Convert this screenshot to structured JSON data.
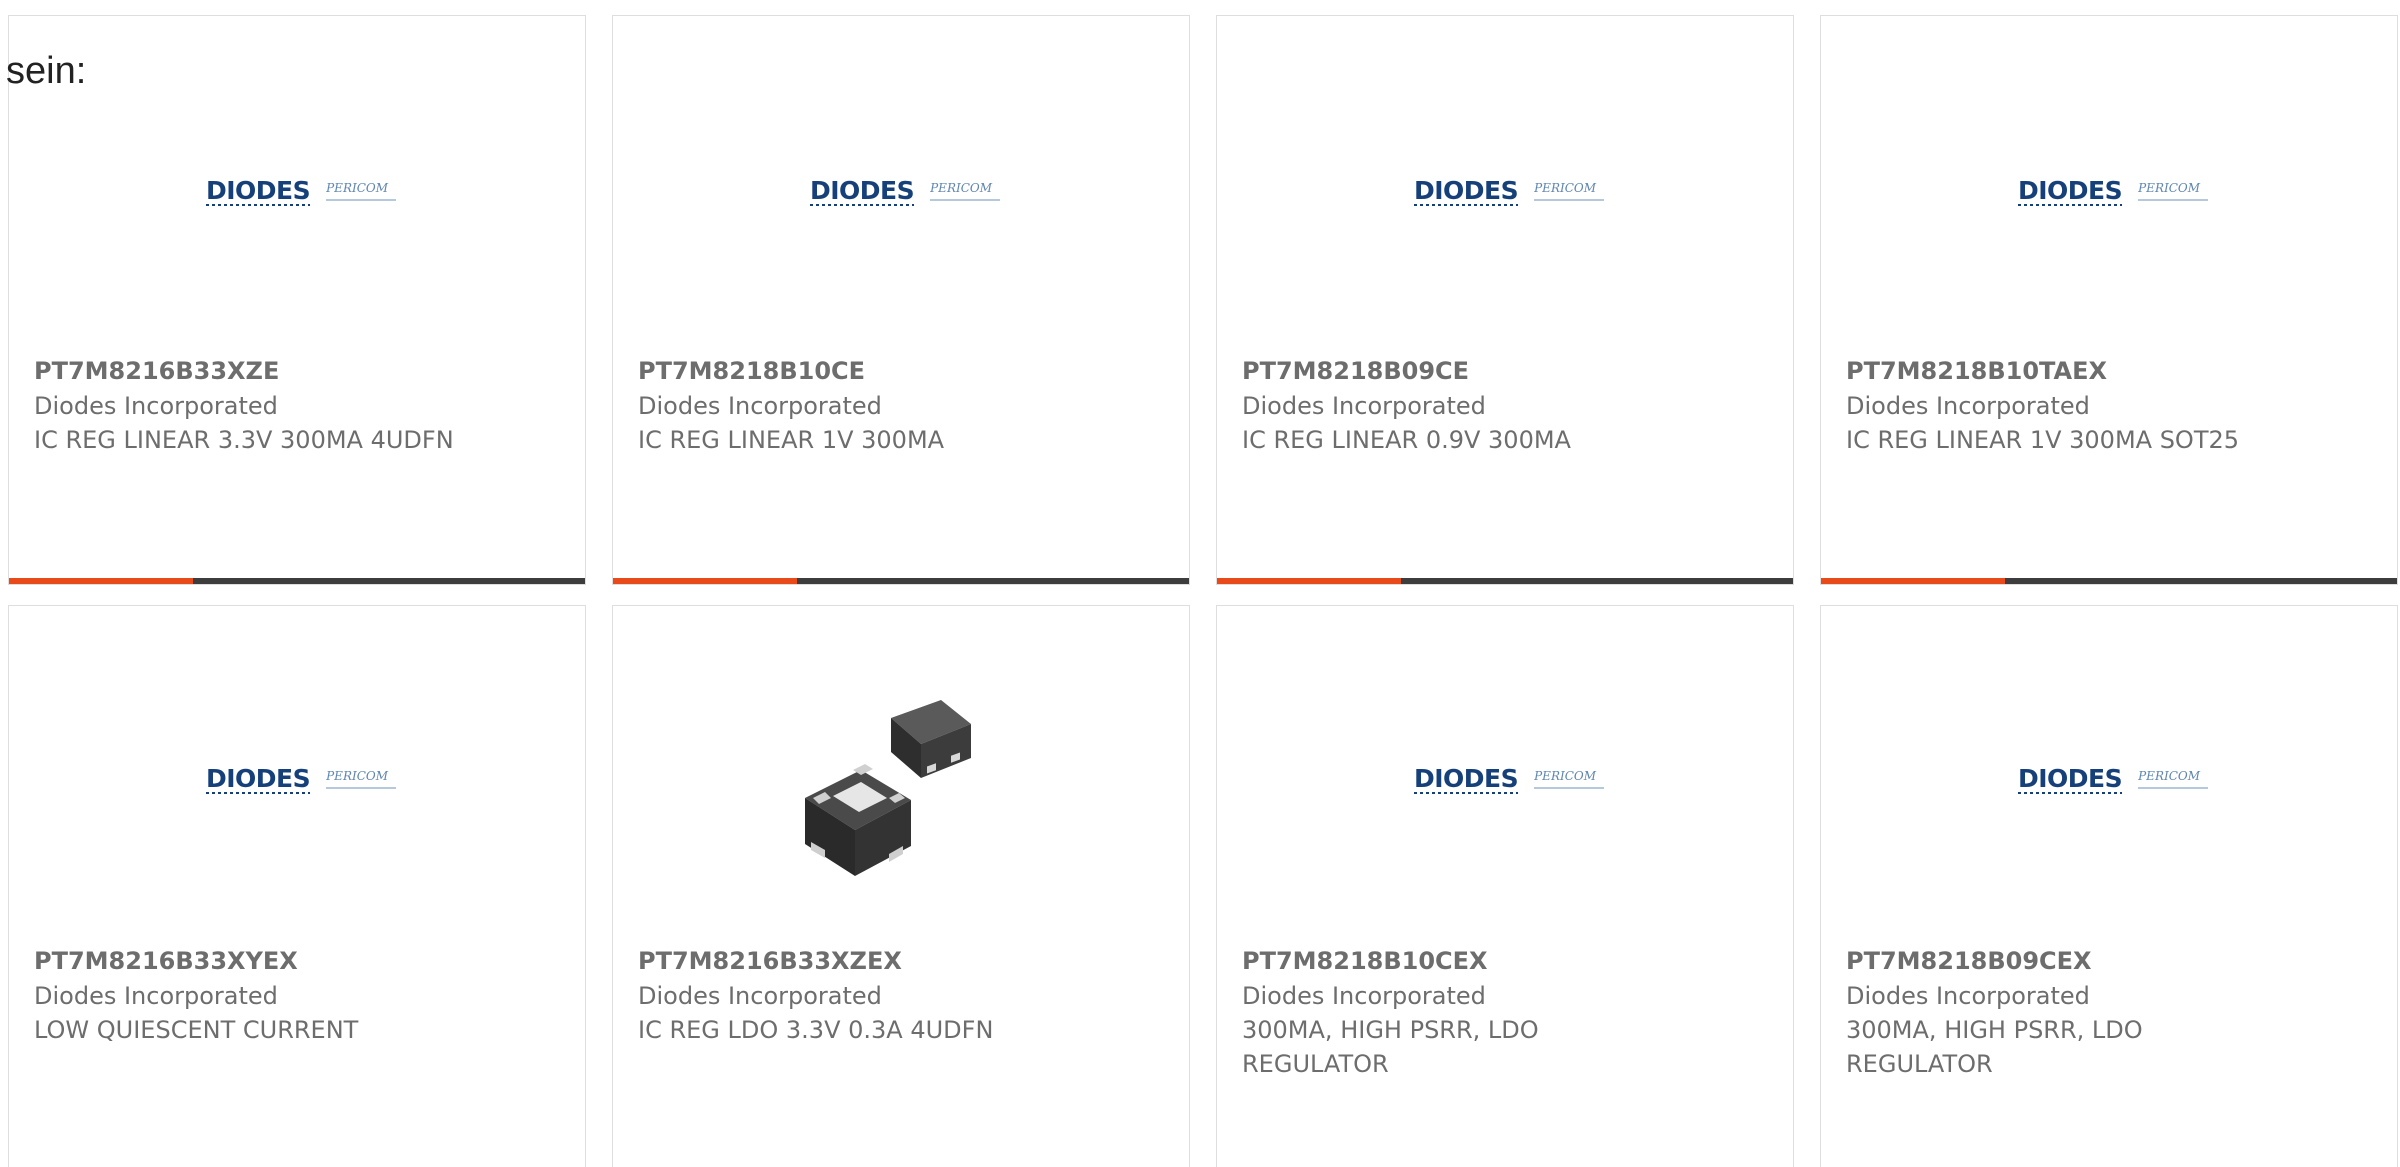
{
  "heading": "sein:",
  "colors": {
    "accent": "#e84a19",
    "bar_track": "#3d3d3d",
    "text": "#6d6d6d",
    "logo_blue": "#16407a"
  },
  "logo": {
    "brand": "DIODES",
    "sub_brand": "PERICOM"
  },
  "products": [
    {
      "part_number": "PT7M8216B33XZE",
      "manufacturer": "Diodes Incorporated",
      "description": "IC REG LINEAR 3.3V 300MA 4UDFN",
      "image": "diodes-pericom-logo",
      "progress_fraction": 0.32
    },
    {
      "part_number": "PT7M8218B10CE",
      "manufacturer": "Diodes Incorporated",
      "description": "IC REG LINEAR 1V 300MA",
      "image": "diodes-pericom-logo",
      "progress_fraction": 0.32
    },
    {
      "part_number": "PT7M8218B09CE",
      "manufacturer": "Diodes Incorporated",
      "description": "IC REG LINEAR 0.9V 300MA",
      "image": "diodes-pericom-logo",
      "progress_fraction": 0.32
    },
    {
      "part_number": "PT7M8218B10TAEX",
      "manufacturer": "Diodes Incorporated",
      "description": "IC REG LINEAR 1V 300MA SOT25",
      "image": "diodes-pericom-logo",
      "progress_fraction": 0.32
    },
    {
      "part_number": "PT7M8216B33XYEX",
      "manufacturer": "Diodes Incorporated",
      "description": "LOW QUIESCENT CURRENT",
      "image": "diodes-pericom-logo"
    },
    {
      "part_number": "PT7M8216B33XZEX",
      "manufacturer": "Diodes Incorporated",
      "description": "IC REG LDO 3.3V 0.3A 4UDFN",
      "image": "udfn-package-photo"
    },
    {
      "part_number": "PT7M8218B10CEX",
      "manufacturer": "Diodes Incorporated",
      "description": "300MA, HIGH PSRR, LDO REGULATOR",
      "image": "diodes-pericom-logo"
    },
    {
      "part_number": "PT7M8218B09CEX",
      "manufacturer": "Diodes Incorporated",
      "description": "300MA, HIGH PSRR, LDO REGULATOR",
      "image": "diodes-pericom-logo"
    }
  ]
}
